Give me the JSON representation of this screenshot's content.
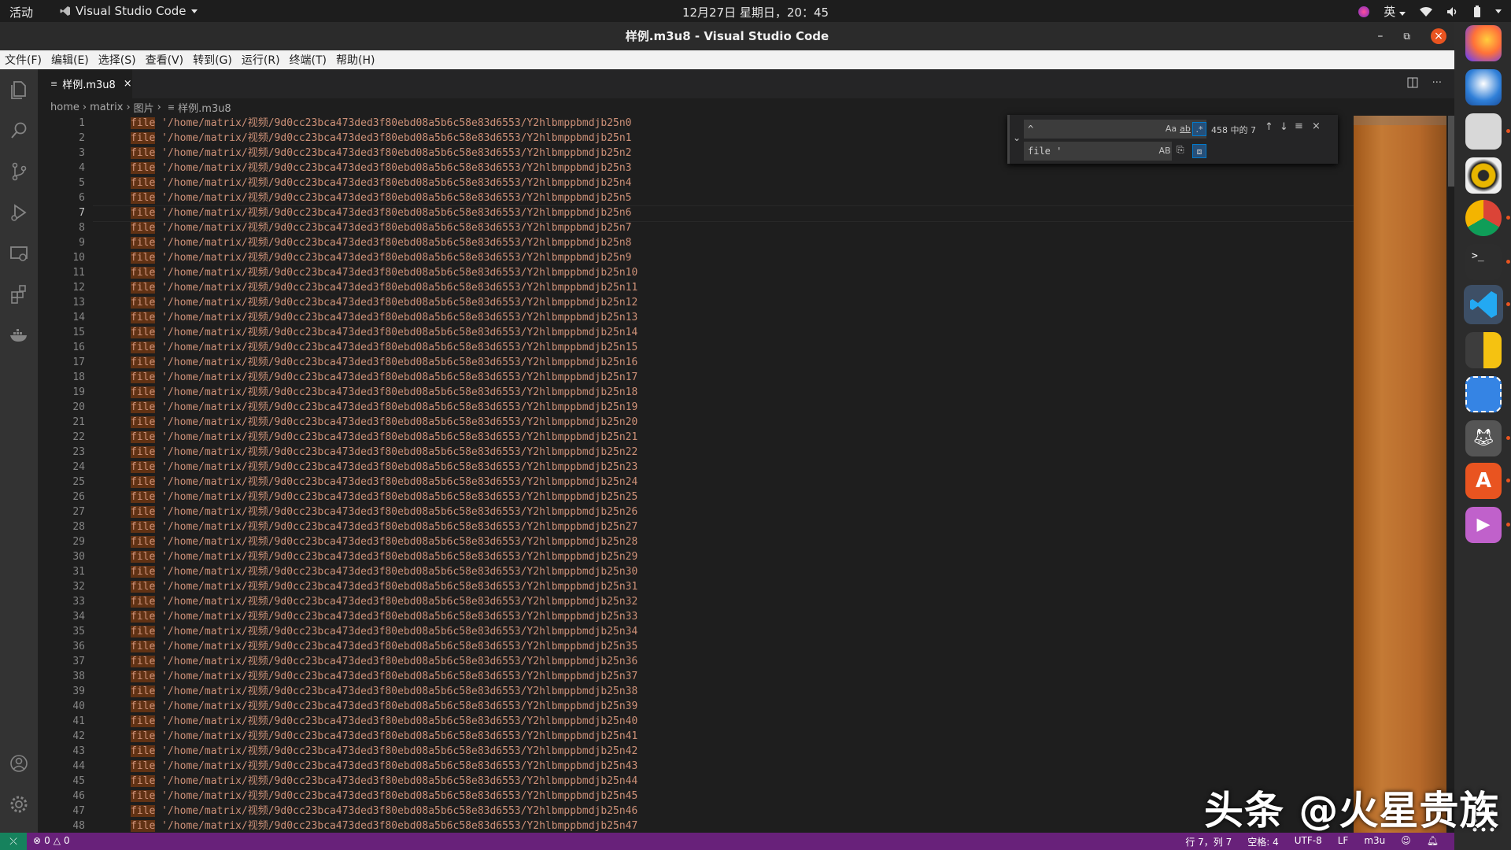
{
  "topbar": {
    "activities": "活动",
    "app_name": "Visual Studio Code",
    "clock": "12月27日 星期日，20：45",
    "input_method": "英"
  },
  "window": {
    "title": "样例.m3u8 - Visual Studio Code"
  },
  "menu": [
    "文件(F)",
    "编辑(E)",
    "选择(S)",
    "查看(V)",
    "转到(G)",
    "运行(R)",
    "终端(T)",
    "帮助(H)"
  ],
  "tab": {
    "label": "样例.m3u8"
  },
  "breadcrumb": [
    "home",
    "matrix",
    "图片",
    "样例.m3u8"
  ],
  "editor": {
    "keyword": "file",
    "path_prefix": " '/home/matrix/视频/9d0cc23bca473ded3f80ebd08a5b6c58e83d6553/Y2hlbmppbmdjb25n",
    "line_count": 48,
    "current_line": 7
  },
  "find": {
    "search_value": "^",
    "result_count": "458 中的 7",
    "replace_value": "file '",
    "opt_case": "Aa",
    "opt_word": "ab",
    "opt_regex": ".*",
    "opt_preserve_case": "AB"
  },
  "statusbar": {
    "errors": "0",
    "warnings": "0",
    "position": "行 7，列 7",
    "indent": "空格: 4",
    "encoding": "UTF-8",
    "eol": "LF",
    "language": "m3u"
  },
  "watermark": "头条 @火星贵族",
  "colors": {
    "statusbar": "#68217a",
    "string": "#ce9178",
    "accent": "#007acc"
  }
}
